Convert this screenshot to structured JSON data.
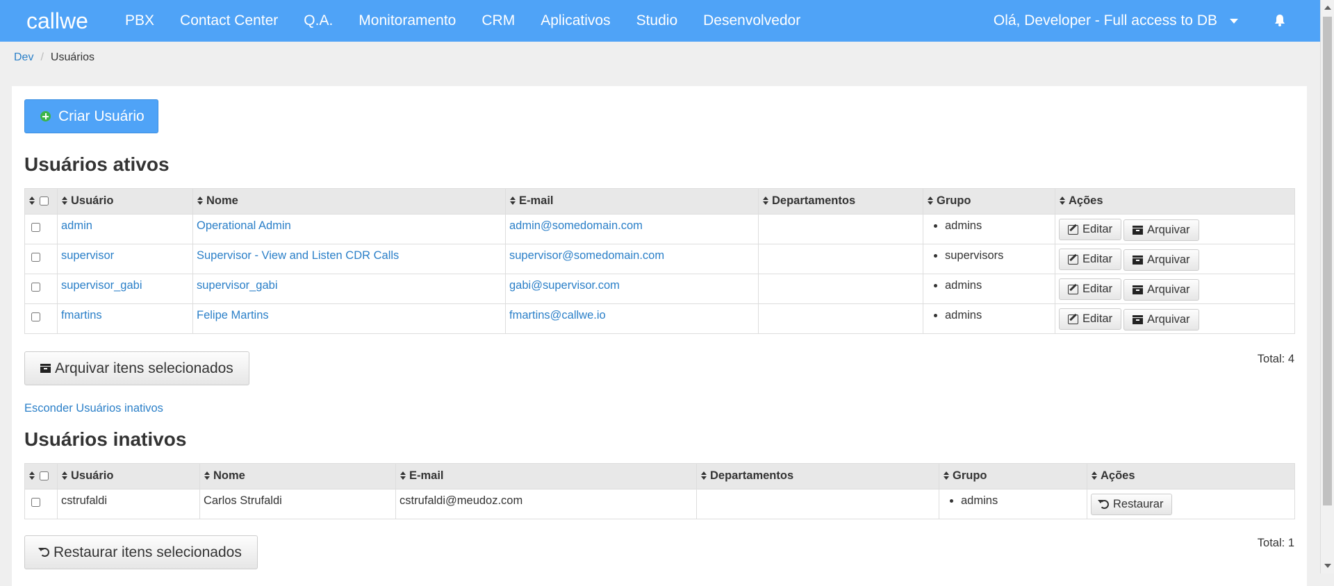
{
  "navbar": {
    "logo": "callwe",
    "links": [
      "PBX",
      "Contact Center",
      "Q.A.",
      "Monitoramento",
      "CRM",
      "Aplicativos",
      "Studio",
      "Desenvolvedor"
    ],
    "user_greeting": "Olá, Developer - Full access to DB"
  },
  "breadcrumb": {
    "root": "Dev",
    "separator": "/",
    "current": "Usuários"
  },
  "create_button": "Criar Usuário",
  "active": {
    "title": "Usuários ativos",
    "columns": [
      "Usuário",
      "Nome",
      "E-mail",
      "Departamentos",
      "Grupo",
      "Ações"
    ],
    "rows": [
      {
        "user": "admin",
        "name": "Operational Admin",
        "email": "admin@somedomain.com",
        "dept": "",
        "group": "admins"
      },
      {
        "user": "supervisor",
        "name": "Supervisor - View and Listen CDR Calls",
        "email": "supervisor@somedomain.com",
        "dept": "",
        "group": "supervisors"
      },
      {
        "user": "supervisor_gabi",
        "name": "supervisor_gabi",
        "email": "gabi@supervisor.com",
        "dept": "",
        "group": "admins"
      },
      {
        "user": "fmartins",
        "name": "Felipe Martins",
        "email": "fmartins@callwe.io",
        "dept": "",
        "group": "admins"
      }
    ],
    "edit_label": "Editar",
    "archive_label": "Arquivar",
    "bulk_button": "Arquivar itens selecionados",
    "total": "Total: 4"
  },
  "toggle_inactive_link": "Esconder Usuários inativos",
  "inactive": {
    "title": "Usuários inativos",
    "columns": [
      "Usuário",
      "Nome",
      "E-mail",
      "Departamentos",
      "Grupo",
      "Ações"
    ],
    "rows": [
      {
        "user": "cstrufaldi",
        "name": "Carlos Strufaldi",
        "email": "cstrufaldi@meudoz.com",
        "dept": "",
        "group": "admins"
      }
    ],
    "restore_label": "Restaurar",
    "bulk_button": "Restaurar itens selecionados",
    "total": "Total: 1"
  },
  "colors": {
    "navbar": "#4fa3f7",
    "link": "#2a7fc8",
    "plus_icon": "#3cb54a"
  }
}
